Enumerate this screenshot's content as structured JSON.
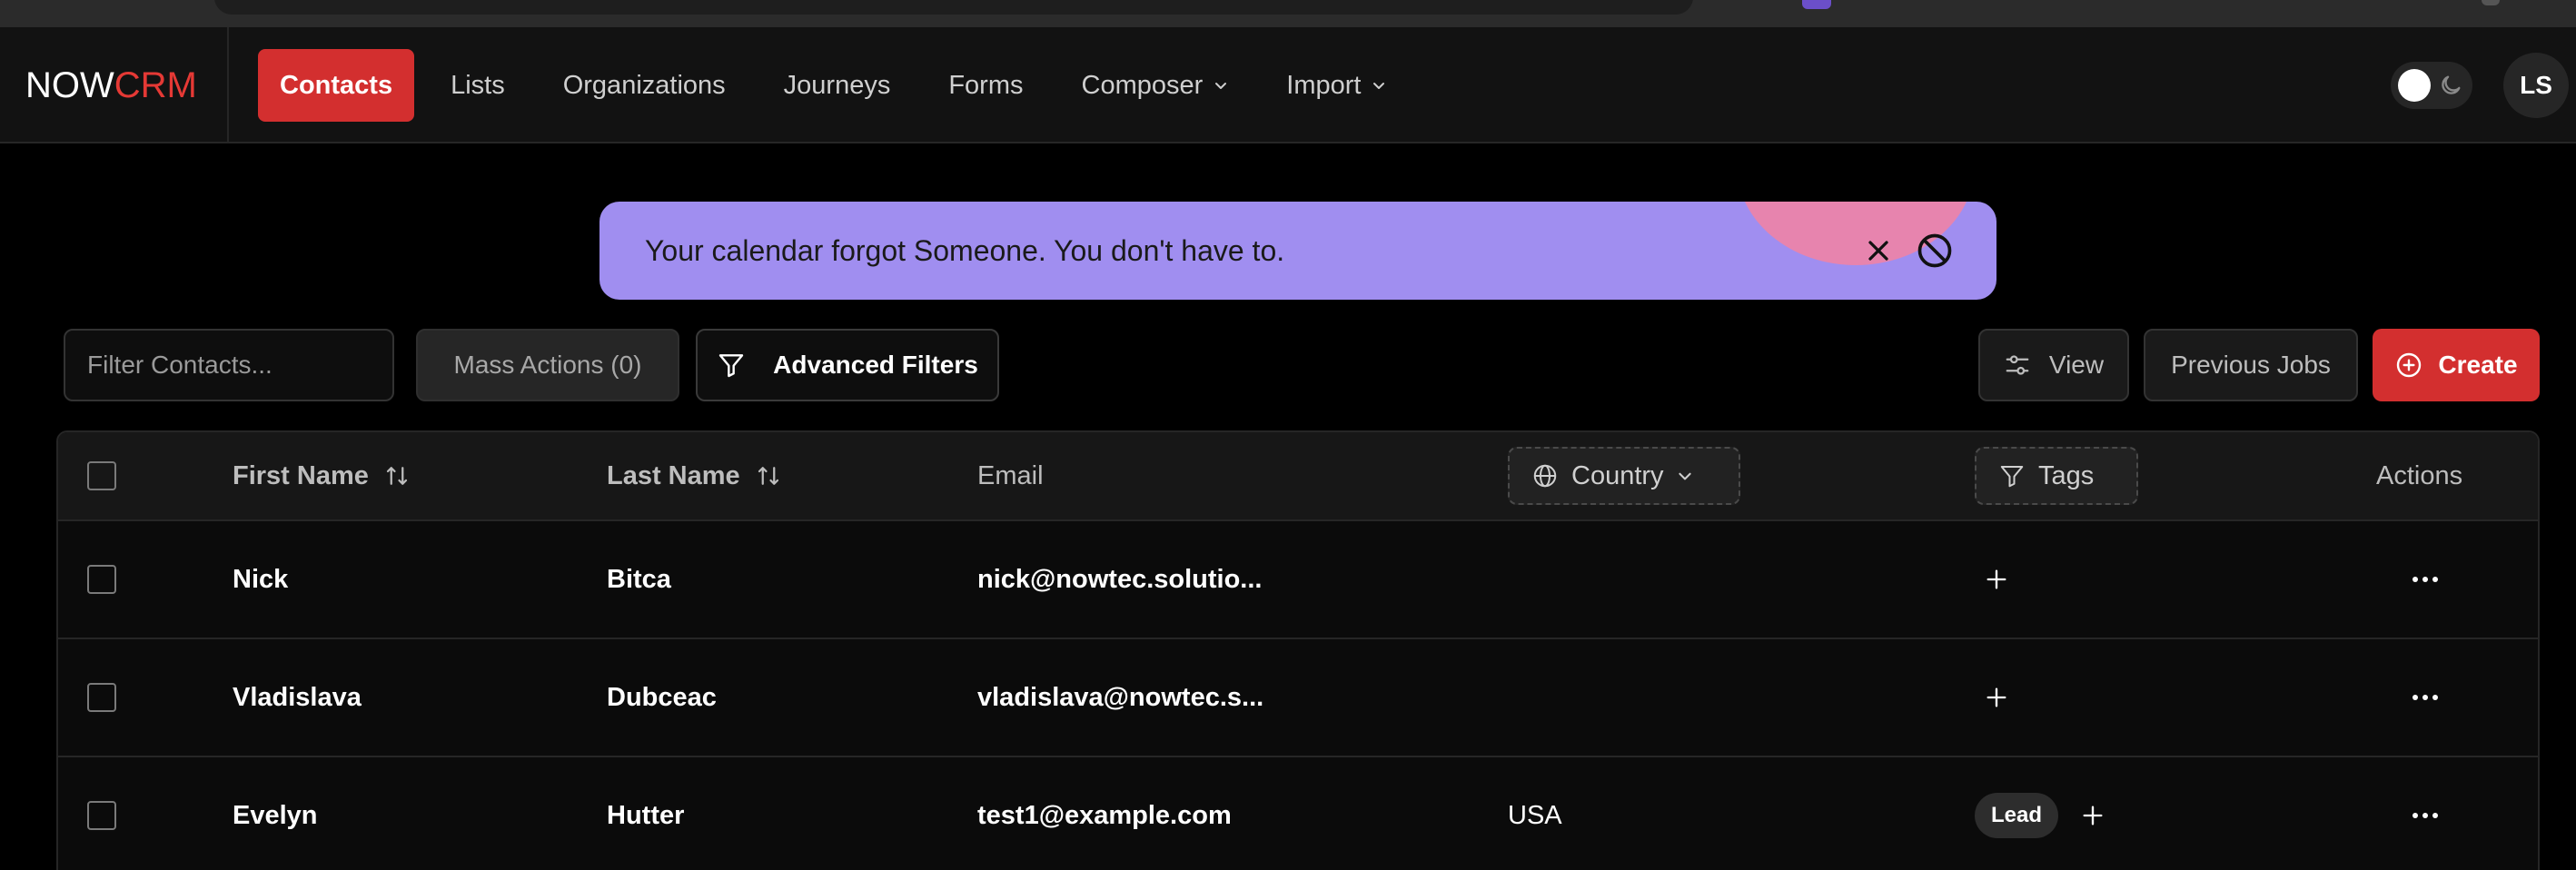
{
  "app": {
    "logo_now": "NOW",
    "logo_crm": "CRM",
    "brand_color": "#d32f2f"
  },
  "nav": {
    "items": [
      {
        "label": "Contacts",
        "active": true
      },
      {
        "label": "Lists"
      },
      {
        "label": "Organizations"
      },
      {
        "label": "Journeys"
      },
      {
        "label": "Forms"
      },
      {
        "label": "Composer",
        "dropdown": true
      },
      {
        "label": "Import",
        "dropdown": true
      }
    ]
  },
  "user": {
    "initials": "LS"
  },
  "banner": {
    "text": "Your calendar forgot Someone. You don't have to.",
    "background": "#a08ef0",
    "accent": "#e784ae"
  },
  "toolbar": {
    "filter_placeholder": "Filter Contacts...",
    "mass_actions_label": "Mass Actions (0)",
    "advanced_filters_label": "Advanced Filters",
    "view_label": "View",
    "previous_jobs_label": "Previous Jobs",
    "create_label": "Create"
  },
  "table": {
    "headers": {
      "first_name": "First Name",
      "last_name": "Last Name",
      "email": "Email",
      "country": "Country",
      "tags": "Tags",
      "actions": "Actions"
    },
    "rows": [
      {
        "first_name": "Nick",
        "last_name": "Bitca",
        "email": "nick@nowtec.solutio...",
        "country": "",
        "tags": []
      },
      {
        "first_name": "Vladislava",
        "last_name": "Dubceac",
        "email": "vladislava@nowtec.s...",
        "country": "",
        "tags": []
      },
      {
        "first_name": "Evelyn",
        "last_name": "Hutter",
        "email": "test1@example.com",
        "country": "USA",
        "tags": [
          "Lead"
        ]
      }
    ]
  }
}
